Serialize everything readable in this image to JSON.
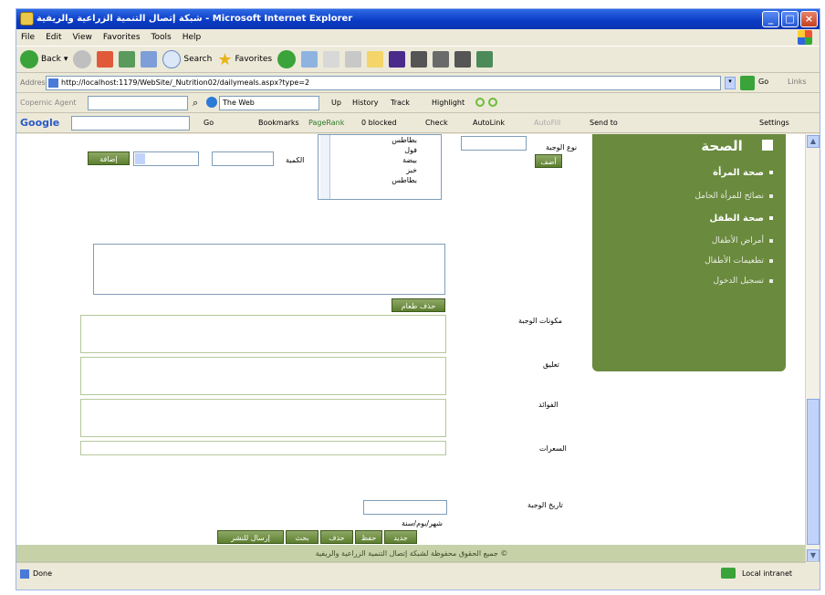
{
  "window": {
    "title": "شبكة إتصال التنمية الزراعية والريفية - Microsoft Internet Explorer",
    "min": "_",
    "max": "□",
    "close": "×"
  },
  "menu": [
    "File",
    "Edit",
    "View",
    "Favorites",
    "Tools",
    "Help"
  ],
  "toolbar": {
    "back": "Back",
    "search": "Search",
    "favorites": "Favorites"
  },
  "address": {
    "label": "Address",
    "url": "http://localhost:1179/WebSite/_Nutrition02/dailymeals.aspx?type=2",
    "go": "Go",
    "links": "Links"
  },
  "links_bar": {
    "copernic": "Copernic Agent",
    "the_web": "The Web",
    "up": "Up",
    "history": "History",
    "track": "Track",
    "highlight": "Highlight"
  },
  "google_bar": {
    "brand": "Google",
    "go": "Go",
    "bookmarks": "Bookmarks",
    "pagerank": "PageRank",
    "blocked": "0 blocked",
    "check": "Check",
    "autolink": "AutoLink",
    "autofill": "AutoFill",
    "send_to": "Send to",
    "settings": "Settings"
  },
  "form": {
    "type_label": "نوع الوجبة",
    "qty_label": "الكمية",
    "add_button": "أضف",
    "add_item_button": "إضافة",
    "foods": [
      "بطاطس",
      "فول",
      "بيضة",
      "خبز",
      "بطاطس"
    ],
    "delete_food_button": "حذف طعام",
    "meal_components_label": "مكونات الوجبة",
    "notes_label": "تعليق",
    "benefits_label": "الفوائد",
    "calories_label": "السعرات",
    "date_label": "تاريخ الوجبة",
    "date_hint": "شهر/يوم/سنة",
    "buttons": [
      "جديد",
      "حفظ",
      "حذف",
      "بحث",
      "إرسال للنشر"
    ]
  },
  "sidebar": {
    "header": "الصحة",
    "items": [
      {
        "label": "صحة المرأة",
        "bold": true
      },
      {
        "label": "نصائح للمرأة الحامل",
        "bold": false
      },
      {
        "label": "صحة الطفل",
        "bold": true
      },
      {
        "label": "أمراض الأطفال",
        "bold": false
      },
      {
        "label": "تطعيمات الأطفال",
        "bold": false
      },
      {
        "label": "تسجيل الدخول",
        "bold": false
      }
    ]
  },
  "footer_text": "جميع الحقوق محفوظة لشبكة إتصال التنمية الزراعية والريفية ©",
  "status": {
    "left": "Done",
    "right": "Local intranet"
  },
  "colors": {
    "accent_green": "#6a8a3e",
    "xp_blue": "#0a3ac4"
  }
}
